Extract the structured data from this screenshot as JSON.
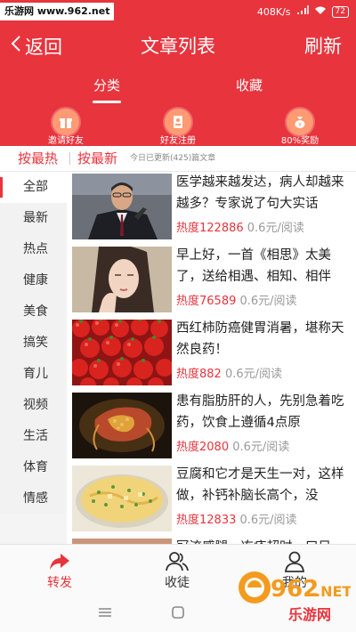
{
  "status_bar": {
    "watermark": "乐游网 www.962.net",
    "network_speed": "408K/s",
    "battery": "72"
  },
  "nav": {
    "back_label": "返回",
    "title": "文章列表",
    "refresh_label": "刷新"
  },
  "tabs": {
    "items": [
      "分类",
      "收藏"
    ],
    "active": "分类"
  },
  "promos": [
    {
      "label": "邀请好友",
      "icon": "gift-icon"
    },
    {
      "label": "好友注册",
      "icon": "register-icon"
    },
    {
      "label": "80%奖励",
      "icon": "reward-bag-icon"
    }
  ],
  "filters": {
    "hot": "按最热",
    "newest": "按最新",
    "update_note": "今日已更新(425)篇文章"
  },
  "categories": [
    "全部",
    "最新",
    "热点",
    "健康",
    "美食",
    "搞笑",
    "育儿",
    "视频",
    "生活",
    "体育",
    "情感"
  ],
  "active_category": "全部",
  "articles": [
    {
      "title": "医学越来越发达，病人却越来越多？专家说了句大实话",
      "heat": "热度122886",
      "price": "0.6元/阅读"
    },
    {
      "title": "早上好，一首《相思》太美了，送给相遇、相知、相伴",
      "heat": "热度76589",
      "price": "0.6元/阅读"
    },
    {
      "title": "西红柿防癌健胃消暑，堪称天然良药！",
      "heat": "热度882",
      "price": "0.6元/阅读"
    },
    {
      "title": "患有脂肪肝的人，先别急着吃药，饮食上遵循4点原",
      "heat": "热度2080",
      "price": "0.6元/阅读"
    },
    {
      "title": "豆腐和它才是天生一对，这样做，补钙补脑长高个，没",
      "heat": "热度12833",
      "price": "0.6元/阅读"
    },
    {
      "title": "冠流感腿，冻疮超时，口目",
      "heat": "",
      "price": ""
    }
  ],
  "bottom_tabs": {
    "forward": "转发",
    "fans": "收徒",
    "mine": "我的"
  },
  "colors": {
    "primary": "#e8343d",
    "meta_gray": "#999999"
  },
  "corner_watermark": "962.NET 乐游网"
}
